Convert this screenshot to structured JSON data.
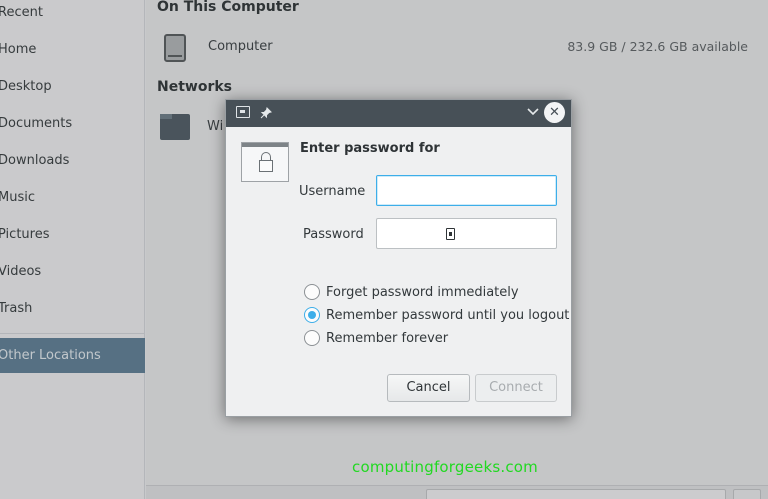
{
  "sidebar": {
    "items": [
      {
        "label": "Recent"
      },
      {
        "label": "Home"
      },
      {
        "label": "Desktop"
      },
      {
        "label": "Documents"
      },
      {
        "label": "Downloads"
      },
      {
        "label": "Music"
      },
      {
        "label": "Pictures"
      },
      {
        "label": "Videos"
      },
      {
        "label": "Trash"
      }
    ],
    "selected": {
      "label": "Other Locations"
    }
  },
  "main": {
    "on_this_computer_title": "On This Computer",
    "computer": {
      "label": "Computer",
      "available": "83.9 GB / 232.6 GB available",
      "icon": "drive-icon"
    },
    "networks_title": "Networks",
    "network_item": {
      "label": "Wi",
      "icon": "network-folder-icon"
    }
  },
  "dialog": {
    "titlebar": {
      "app_icon": "app-icon",
      "pin_icon": "pin-icon",
      "minimize_icon": "chevron-down-icon",
      "close_glyph": "✕"
    },
    "heading": "Enter password for",
    "username_label": "Username",
    "username_value": "",
    "password_label": "Password",
    "options": [
      {
        "label": "Forget password immediately",
        "checked": false
      },
      {
        "label": "Remember password until you logout",
        "checked": true
      },
      {
        "label": "Remember forever",
        "checked": false
      }
    ],
    "cancel_label": "Cancel",
    "connect_label": "Connect",
    "accent_color": "#3daee9"
  },
  "watermark": "computingforgeeks.com"
}
